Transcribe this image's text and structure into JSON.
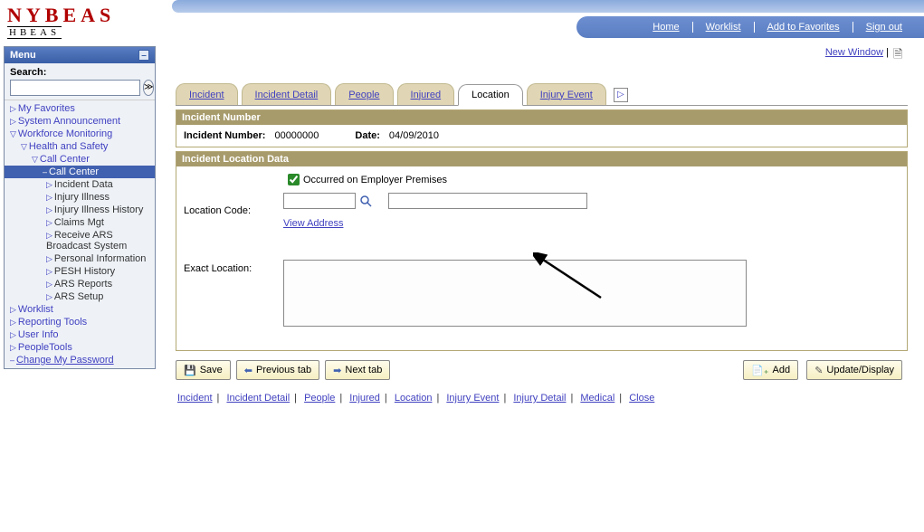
{
  "logo": {
    "main": "NYBEAS",
    "sub": "HBEAS"
  },
  "topnav": {
    "home": "Home",
    "worklist": "Worklist",
    "add_fav": "Add to Favorites",
    "sign_out": "Sign out"
  },
  "menu": {
    "title": "Menu",
    "search_label": "Search:",
    "search_value": "",
    "items": {
      "favorites": "My Favorites",
      "sys_ann": "System Announcement",
      "workforce": "Workforce Monitoring",
      "health_safety": "Health and Safety",
      "call_center": "Call Center",
      "call_center_sub": "Call Center",
      "incident_data": "Incident Data",
      "injury_illness": "Injury Illness",
      "injury_history": "Injury Illness History",
      "claims_mgt": "Claims Mgt",
      "ars_broadcast": "Receive ARS Broadcast System",
      "personal_info": "Personal Information",
      "pesh_history": "PESH History",
      "ars_reports": "ARS Reports",
      "ars_setup": "ARS Setup",
      "worklist": "Worklist",
      "reporting": "Reporting Tools",
      "user_info": "User Info",
      "peopletools": "PeopleTools",
      "change_pw": "Change My Password"
    }
  },
  "ur": {
    "new_window": "New Window"
  },
  "tabs": {
    "incident": "Incident",
    "incident_detail": "Incident Detail",
    "people": "People",
    "injured": "Injured",
    "location": "Location",
    "injury_event": "Injury Event"
  },
  "panel1": {
    "title": "Incident Number",
    "num_label": "Incident Number:",
    "num_value": "00000000",
    "date_label": "Date:",
    "date_value": "04/09/2010"
  },
  "panel2": {
    "title": "Incident Location Data",
    "occurred_label": "Occurred on Employer Premises",
    "loc_code_label": "Location Code:",
    "loc_code_value": "",
    "loc_desc_value": "",
    "view_address": "View Address",
    "exact_label": "Exact Location:",
    "exact_value": ""
  },
  "buttons": {
    "save": "Save",
    "prev_tab": "Previous tab",
    "next_tab": "Next tab",
    "add": "Add",
    "update": "Update/Display"
  },
  "breadcrumb": {
    "incident": "Incident",
    "incident_detail": "Incident Detail",
    "people": "People",
    "injured": "Injured",
    "location": "Location",
    "injury_event": "Injury Event",
    "injury_detail": "Injury Detail",
    "medical": "Medical",
    "close": "Close"
  }
}
